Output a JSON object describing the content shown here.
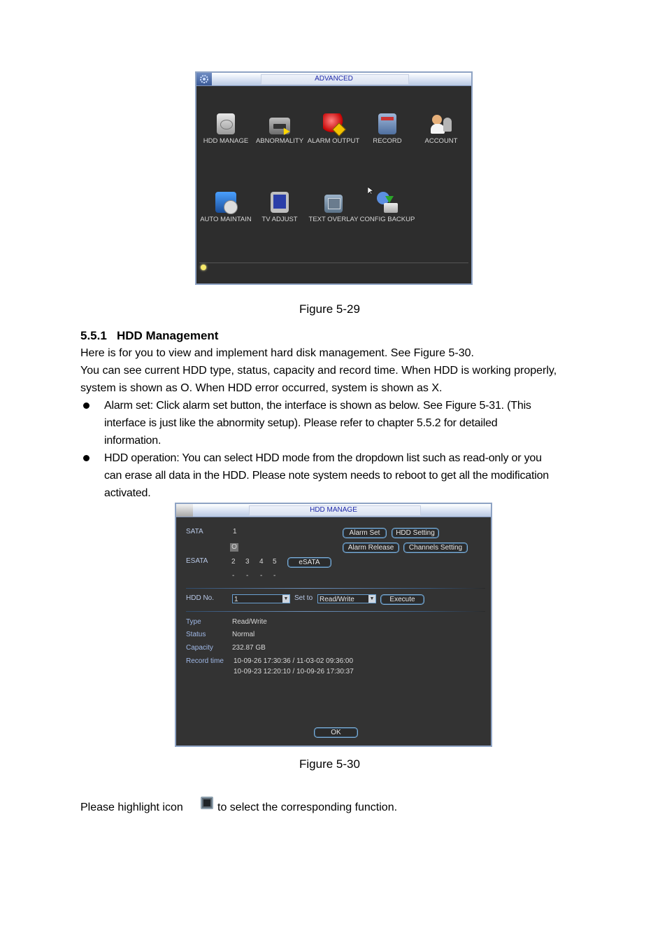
{
  "figure_529": {
    "window_title": "ADVANCED",
    "icons": [
      {
        "label": "HDD MANAGE",
        "icon": "hdd-icon"
      },
      {
        "label": "ABNORMALITY",
        "icon": "error-window-icon"
      },
      {
        "label": "ALARM OUTPUT",
        "icon": "alarm-light-icon"
      },
      {
        "label": "RECORD",
        "icon": "record-panel-icon"
      },
      {
        "label": "ACCOUNT",
        "icon": "user-lock-icon"
      },
      {
        "label": "AUTO MAINTAIN",
        "icon": "clock-cube-icon"
      },
      {
        "label": "TV ADJUST",
        "icon": "tv-icon"
      },
      {
        "label": "TEXT OVERLAY",
        "icon": "atm-icon"
      },
      {
        "label": "CONFIG BACKUP",
        "icon": "gear-download-icon"
      }
    ],
    "caption": "Figure 5-29"
  },
  "section": {
    "heading": "5.5.1   HDD Management",
    "para1": "Here is for you to view and implement hard disk management. See Figure 5-30.",
    "para2_line1": "You can see current HDD type, status, capacity and record time. When HDD is working properly,",
    "para2_line2": "system is shown as O. When HDD error occurred, system is shown as X.",
    "bullets": [
      {
        "lines": [
          "Alarm set: Click alarm set button, the interface is shown as below. See Figure 5-31. (This",
          "interface is just like the abnormity setup). Please refer to chapter 5.5.2 for detailed",
          "information."
        ]
      },
      {
        "lines": [
          "HDD operation: You can select HDD mode from the dropdown list such as read-only or you",
          "can erase all data in the HDD. Please note system needs to reboot to get all the modification",
          "activated."
        ]
      }
    ]
  },
  "figure_530": {
    "window_title": "HDD MANAGE",
    "sata_label": "SATA",
    "sata_numbers": [
      "1"
    ],
    "sata_status": [
      "O"
    ],
    "esata_label": "ESATA",
    "esata_numbers": [
      "2",
      "3",
      "4",
      "5"
    ],
    "esata_status": [
      "-",
      "-",
      "-",
      "-"
    ],
    "buttons": {
      "alarm_set": "Alarm Set",
      "hdd_setting": "HDD Setting",
      "alarm_release": "Alarm Release",
      "channels_setting": "Channels Setting",
      "esata": "eSATA",
      "execute": "Execute",
      "ok": "OK"
    },
    "hdd_no_label": "HDD No.",
    "hdd_no_value": "1",
    "set_to_label": "Set to",
    "set_to_value": "Read/Write",
    "info": {
      "type_label": "Type",
      "type_value": "Read/Write",
      "status_label": "Status",
      "status_value": "Normal",
      "capacity_label": "Capacity",
      "capacity_value": "232.87 GB",
      "record_time_label": "Record time",
      "record_time_values": [
        "10-09-26 17:30:36 / 11-03-02 09:36:00",
        "10-09-23 12:20:10 / 10-09-26 17:30:37"
      ]
    },
    "caption": "Figure 5-30"
  },
  "footer": {
    "before_icon": "Please highlight icon",
    "after_icon": "to select the corresponding function.",
    "icon": "highlight-square-icon"
  }
}
